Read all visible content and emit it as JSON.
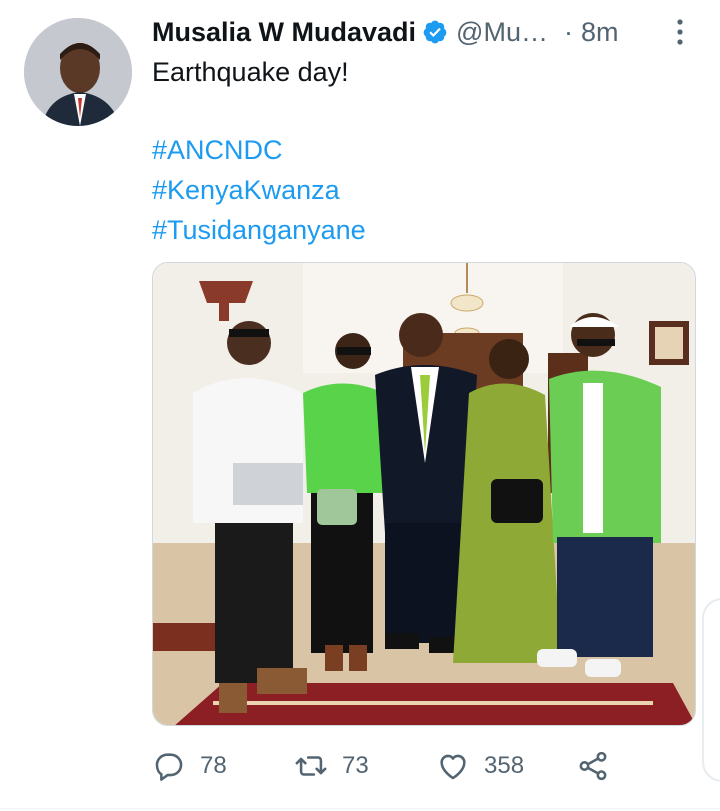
{
  "tweet": {
    "author_name": "Musalia W Mudavadi",
    "handle": "@Mu…",
    "separator": "·",
    "time": "8m",
    "text": "Earthquake day!",
    "hashtags": [
      "#ANCNDC",
      "#KenyaKwanza",
      "#Tusidanganyane"
    ]
  },
  "actions": {
    "replies": "78",
    "retweets": "73",
    "likes": "358"
  },
  "colors": {
    "accent": "#1d9bf0",
    "verified": "#1d9bf0",
    "muted": "#536471"
  },
  "icons": {
    "reply": "reply-icon",
    "retweet": "retweet-icon",
    "like": "heart-icon",
    "share": "share-icon",
    "more": "more-icon",
    "verified": "verified-badge-icon"
  }
}
